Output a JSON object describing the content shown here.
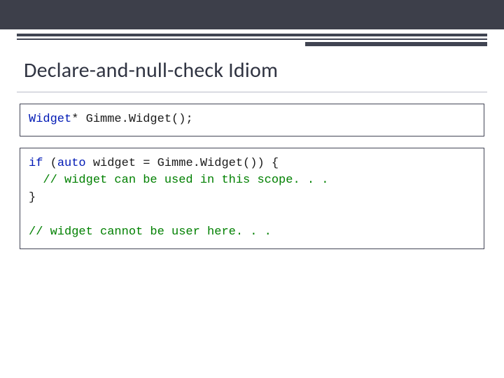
{
  "slide": {
    "title": "Declare-and-null-check Idiom"
  },
  "box1": {
    "t1": "Widget",
    "t2": "* Gimme.Widget();"
  },
  "box2": {
    "l1a": "if",
    "l1b": " (",
    "l1c": "auto",
    "l1d": " widget = Gimme.Widget()) {",
    "l2": "  // widget can be used in this scope. . .",
    "l3": "}",
    "blank": "",
    "l4": "// widget cannot be user here. . ."
  }
}
